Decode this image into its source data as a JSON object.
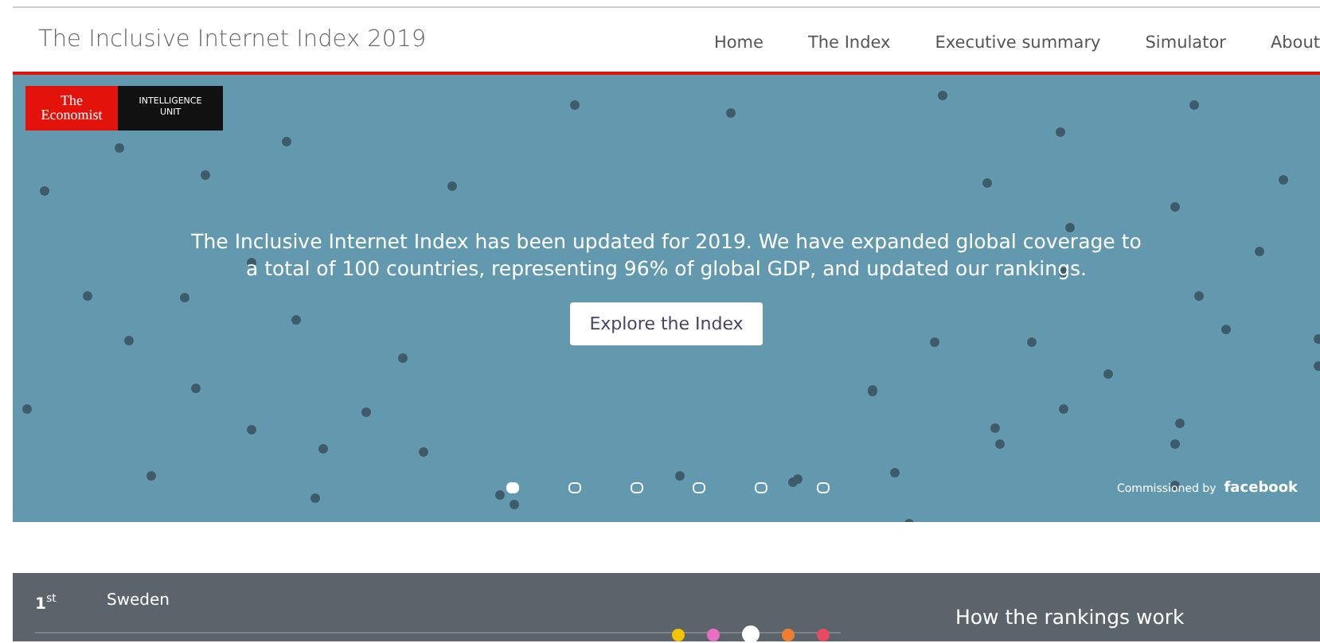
{
  "header": {
    "title": "The Inclusive Internet Index 2019",
    "nav": [
      {
        "label": "Home"
      },
      {
        "label": "The Index"
      },
      {
        "label": "Executive summary"
      },
      {
        "label": "Simulator"
      },
      {
        "label": "About"
      }
    ]
  },
  "hero": {
    "logo": {
      "brand": "The Economist",
      "unit": "INTELLIGENCE UNIT"
    },
    "message": "The Inclusive Internet Index has been updated for 2019. We have expanded global coverage to a total of 100 countries, representing 96% of global GDP, and updated our rankings.",
    "button": "Explore the Index",
    "slides": [
      {
        "selected": true
      },
      {
        "selected": false
      },
      {
        "selected": false
      },
      {
        "selected": false
      },
      {
        "selected": false
      },
      {
        "selected": false
      }
    ],
    "commissioned": {
      "label": "Commissioned by",
      "sponsor": "facebook"
    }
  },
  "ranking": {
    "rank": "1$^{st}$",
    "country": "Sweden",
    "pillars": [
      {
        "color": "#f5c400",
        "selected": false
      },
      {
        "color": "#e86fc4",
        "selected": false
      },
      {
        "color": "#ffffff",
        "selected": true
      },
      {
        "color": "#f08030",
        "selected": false
      },
      {
        "color": "#e84a66",
        "selected": false
      }
    ],
    "link": "How the rankings work"
  }
}
